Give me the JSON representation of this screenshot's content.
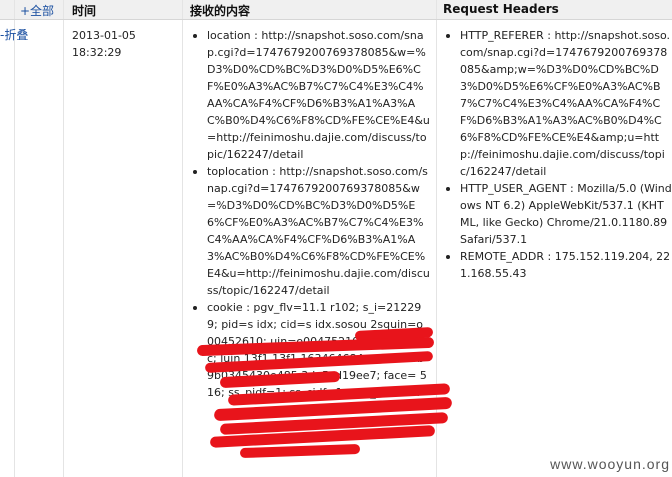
{
  "header": {
    "toggle_all": "+全部",
    "time": "时间",
    "content": "接收的内容",
    "request_headers": "Request Headers"
  },
  "row": {
    "collapse": "-折叠",
    "date": "2013-01-05",
    "time": "18:32:29",
    "content_items": [
      "location : http://snapshot.soso.com/snap.cgi?d=1747679200769378085&w=%D3%D0%CD%BC%D3%D0%D5%E6%CF%E0%A3%AC%B7%C7%C4%E3%C4%AA%CA%F4%CF%D6%B3%A1%A3%AC%B0%D4%C6%F8%CD%FE%CE%E4&u=http://feinimoshu.dajie.com/discuss/topic/162247/detail",
      "toplocation : http://snapshot.soso.com/snap.cgi?d=1747679200769378085&w=%D3%D0%CD%BC%D3%D0%D5%E6%CF%E0%A3%AC%B7%C7%C4%E3%C4%AA%CA%F4%CF%D6%B3%A1%A3%AC%B0%D4%C6%F8%CD%FE%CE%E4&u=http://feinimoshu.dajie.com/discuss/topic/162247/detail",
      "cookie : pgv_flv=11.1 r102; s_i=212299; pid=s idx; cid=s idx.sosou 2squin=o00452610; uin=o00475210 15; isp=cnc; luin 13f1 13f1 163464684cc28bae3b9b0345430e485 3de5cd19ee7; face= 516; ss_pidf=1; ss_cidf=1; pgv_pvid=47"
    ],
    "header_items": [
      "HTTP_REFERER : http://snapshot.soso.com/snap.cgi?d=1747679200769378085&amp;w=%D3%D0%CD%BC%D3%D0%D5%E6%CF%E0%A3%AC%B7%C7%C4%E3%C4%AA%CA%F4%CF%D6%B3%A1%A3%AC%B0%D4%C6%F8%CD%FE%CE%E4&amp;u=http://feinimoshu.dajie.com/discuss/topic/162247/detail",
      "HTTP_USER_AGENT : Mozilla/5.0 (Windows NT 6.2) AppleWebKit/537.1 (KHTML, like Gecko) Chrome/21.0.1180.89 Safari/537.1",
      "REMOTE_ADDR : 175.152.119.204, 221.168.55.43"
    ]
  },
  "watermark": "www.wooyun.org",
  "colors": {
    "link": "#1a4fa0",
    "header_bg": "#f0f0f0",
    "redaction": "#e8141b"
  }
}
